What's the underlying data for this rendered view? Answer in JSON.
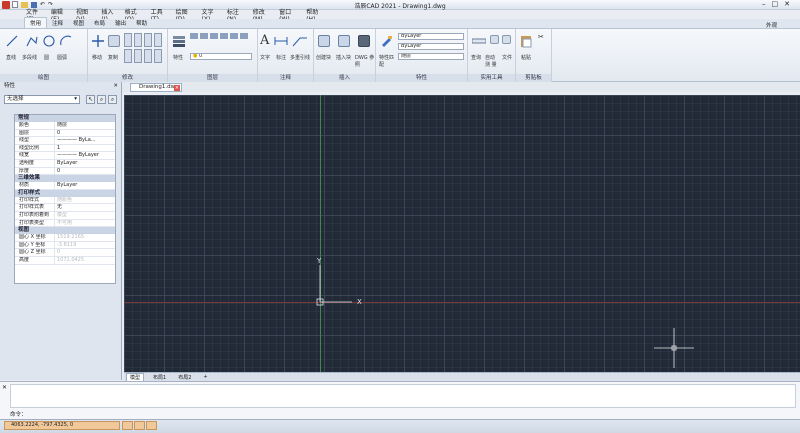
{
  "app": {
    "window_title": "浩辰CAD 2021 - Drawing1.dwg",
    "menus": [
      "文件(F)",
      "编辑(E)",
      "视图(V)",
      "插入(I)",
      "格式(O)",
      "工具(T)",
      "绘图(D)",
      "文字(X)",
      "标注(N)",
      "修改(M)",
      "窗口(W)",
      "帮助(H)"
    ],
    "tabs": [
      "常用",
      "注释",
      "视图",
      "布局",
      "输出",
      "帮助"
    ],
    "right_label": "外观"
  },
  "ribbon": {
    "groups": [
      "绘图",
      "修改",
      "图层",
      "注释",
      "插入",
      "特性",
      "实用工具",
      "剪贴板"
    ],
    "draw_tools": [
      "直线",
      "多段线",
      "圆",
      "圆弧"
    ],
    "modify_tools": [
      "移动",
      "复制"
    ],
    "layer": {
      "button": "特性",
      "combo": "0"
    },
    "annot": [
      "文字",
      "标注",
      "多重引线"
    ],
    "insert": [
      "创建块",
      "插入块",
      "DWG 参照"
    ],
    "props": {
      "match": "特性匹配",
      "combo1": "ByLayer",
      "combo2": "ByLayer",
      "combo3": "随层"
    },
    "util": [
      "查询",
      "自动 测 量",
      "文件"
    ],
    "clip": "粘贴"
  },
  "doc_tab": "Drawing1.dwg",
  "panel": {
    "title": "特性",
    "selection": "无选择",
    "sections": [
      {
        "name": "常规",
        "rows": [
          {
            "k": "颜色",
            "v": "随层",
            "dim": false
          },
          {
            "k": "图层",
            "v": "0",
            "dim": false
          },
          {
            "k": "线型",
            "v": "———— ByLa...",
            "dim": false
          },
          {
            "k": "线型比例",
            "v": "1",
            "dim": false
          },
          {
            "k": "线宽",
            "v": "———— ByLayer",
            "dim": false
          },
          {
            "k": "透明度",
            "v": "ByLayer",
            "dim": false
          },
          {
            "k": "厚度",
            "v": "0",
            "dim": false
          }
        ]
      },
      {
        "name": "三维效果",
        "rows": [
          {
            "k": "材质",
            "v": "ByLayer",
            "dim": false
          }
        ]
      },
      {
        "name": "打印样式",
        "rows": [
          {
            "k": "打印样式",
            "v": "随颜色",
            "dim": true
          },
          {
            "k": "打印样式表",
            "v": "无",
            "dim": false
          },
          {
            "k": "打印表附着到",
            "v": "模型",
            "dim": true
          },
          {
            "k": "打印表类型",
            "v": "不可用",
            "dim": true
          }
        ]
      },
      {
        "name": "视图",
        "rows": [
          {
            "k": "圆心 X 坐标",
            "v": "1519.2165",
            "dim": true
          },
          {
            "k": "圆心 Y 坐标",
            "v": "-3.8119",
            "dim": true
          },
          {
            "k": "圆心 Z 坐标",
            "v": "0",
            "dim": true
          },
          {
            "k": "高度",
            "v": "1071.0425",
            "dim": true
          }
        ]
      }
    ]
  },
  "layout_tabs": [
    "模型",
    "布局1",
    "布局2"
  ],
  "command": {
    "prompt": "命令："
  },
  "status": {
    "coords": "4063.2224, -797.4325, 0"
  },
  "ucs": {
    "x": "X",
    "y": "Y"
  },
  "colors": {
    "canvas": "#212a36",
    "grid": "#3a4656",
    "status_btn": "#f0c89a"
  }
}
